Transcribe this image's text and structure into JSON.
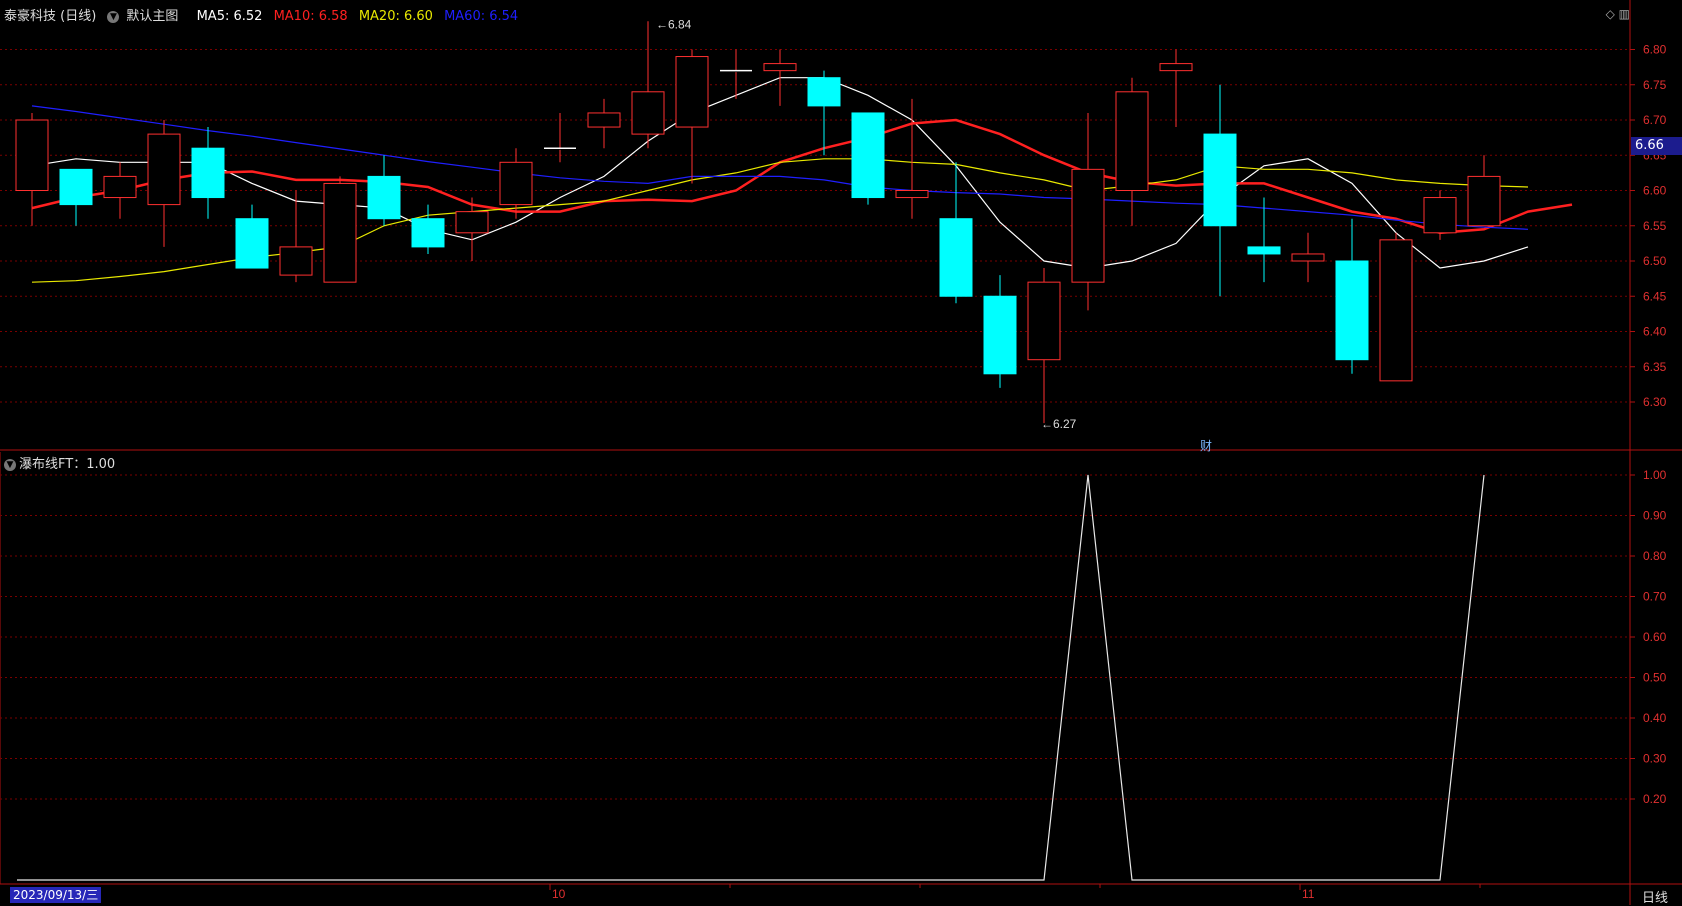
{
  "header": {
    "stock": "泰豪科技 (日线)",
    "main_label": "默认主图",
    "ma": [
      {
        "label": "MA5: 6.52",
        "color": "#ffffff"
      },
      {
        "label": "MA10: 6.58",
        "color": "#ff2020"
      },
      {
        "label": "MA20: 6.60",
        "color": "#e8e800"
      },
      {
        "label": "MA60: 6.54",
        "color": "#1f1fff"
      }
    ]
  },
  "sub_header": "瀑布线FT：1.00",
  "last_price": "6.66",
  "cursor_date": "2023/09/13/三",
  "period": "日线",
  "fin_marker": "财",
  "colors": {
    "up": "#ff3030",
    "down": "#00ffff",
    "grid": "#7a0000",
    "axis": "#b01010"
  },
  "chart_data": {
    "type": "candlestick",
    "y_ticks": [
      "6.80",
      "6.75",
      "6.70",
      "6.65",
      "6.60",
      "6.55",
      "6.50",
      "6.45",
      "6.40",
      "6.35",
      "6.30"
    ],
    "sub_y_ticks": [
      "1.00",
      "0.90",
      "0.80",
      "0.70",
      "0.60",
      "0.50",
      "0.40",
      "0.30",
      "0.20"
    ],
    "x_labels": [
      "10",
      "11"
    ],
    "annotations": {
      "high": "6.84",
      "low": "6.27"
    },
    "candles": [
      {
        "o": 6.6,
        "h": 6.71,
        "l": 6.55,
        "c": 6.7
      },
      {
        "o": 6.63,
        "h": 6.63,
        "l": 6.55,
        "c": 6.58
      },
      {
        "o": 6.59,
        "h": 6.64,
        "l": 6.56,
        "c": 6.62
      },
      {
        "o": 6.58,
        "h": 6.7,
        "l": 6.52,
        "c": 6.68
      },
      {
        "o": 6.66,
        "h": 6.69,
        "l": 6.56,
        "c": 6.59
      },
      {
        "o": 6.56,
        "h": 6.58,
        "l": 6.49,
        "c": 6.49
      },
      {
        "o": 6.48,
        "h": 6.6,
        "l": 6.47,
        "c": 6.52
      },
      {
        "o": 6.47,
        "h": 6.62,
        "l": 6.47,
        "c": 6.61
      },
      {
        "o": 6.62,
        "h": 6.65,
        "l": 6.55,
        "c": 6.56
      },
      {
        "o": 6.56,
        "h": 6.58,
        "l": 6.51,
        "c": 6.52
      },
      {
        "o": 6.54,
        "h": 6.59,
        "l": 6.5,
        "c": 6.57
      },
      {
        "o": 6.58,
        "h": 6.66,
        "l": 6.56,
        "c": 6.64
      },
      {
        "o": 6.66,
        "h": 6.71,
        "l": 6.64,
        "c": 6.66
      },
      {
        "o": 6.69,
        "h": 6.73,
        "l": 6.66,
        "c": 6.71
      },
      {
        "o": 6.68,
        "h": 6.84,
        "l": 6.66,
        "c": 6.74
      },
      {
        "o": 6.69,
        "h": 6.8,
        "l": 6.61,
        "c": 6.79
      },
      {
        "o": 6.77,
        "h": 6.8,
        "l": 6.73,
        "c": 6.77
      },
      {
        "o": 6.77,
        "h": 6.8,
        "l": 6.72,
        "c": 6.78
      },
      {
        "o": 6.76,
        "h": 6.77,
        "l": 6.65,
        "c": 6.72
      },
      {
        "o": 6.71,
        "h": 6.71,
        "l": 6.58,
        "c": 6.59
      },
      {
        "o": 6.59,
        "h": 6.73,
        "l": 6.56,
        "c": 6.6
      },
      {
        "o": 6.56,
        "h": 6.64,
        "l": 6.44,
        "c": 6.45
      },
      {
        "o": 6.45,
        "h": 6.48,
        "l": 6.32,
        "c": 6.34
      },
      {
        "o": 6.36,
        "h": 6.49,
        "l": 6.27,
        "c": 6.47
      },
      {
        "o": 6.47,
        "h": 6.71,
        "l": 6.43,
        "c": 6.63
      },
      {
        "o": 6.6,
        "h": 6.76,
        "l": 6.55,
        "c": 6.74
      },
      {
        "o": 6.77,
        "h": 6.8,
        "l": 6.69,
        "c": 6.78
      },
      {
        "o": 6.68,
        "h": 6.75,
        "l": 6.45,
        "c": 6.55
      },
      {
        "o": 6.52,
        "h": 6.59,
        "l": 6.47,
        "c": 6.51
      },
      {
        "o": 6.5,
        "h": 6.54,
        "l": 6.47,
        "c": 6.51
      },
      {
        "o": 6.5,
        "h": 6.56,
        "l": 6.34,
        "c": 6.36
      },
      {
        "o": 6.33,
        "h": 6.54,
        "l": 6.33,
        "c": 6.53
      },
      {
        "o": 6.54,
        "h": 6.6,
        "l": 6.53,
        "c": 6.59
      },
      {
        "o": 6.55,
        "h": 6.65,
        "l": 6.55,
        "c": 6.62
      }
    ],
    "series": [
      {
        "name": "MA5",
        "color": "#ffffff",
        "values": [
          6.635,
          6.645,
          6.64,
          6.64,
          6.64,
          6.61,
          6.585,
          6.58,
          6.575,
          6.545,
          6.53,
          6.555,
          6.59,
          6.62,
          6.67,
          6.71,
          6.735,
          6.76,
          6.76,
          6.735,
          6.7,
          6.635,
          6.555,
          6.5,
          6.49,
          6.5,
          6.525,
          6.59,
          6.635,
          6.645,
          6.61,
          6.54,
          6.49,
          6.5,
          6.52
        ]
      },
      {
        "name": "MA10",
        "color": "#ff2020",
        "values": [
          6.575,
          6.59,
          6.6,
          6.615,
          6.625,
          6.627,
          6.615,
          6.615,
          6.612,
          6.605,
          6.58,
          6.57,
          6.57,
          6.585,
          6.587,
          6.585,
          6.6,
          6.64,
          6.66,
          6.675,
          6.695,
          6.7,
          6.68,
          6.65,
          6.625,
          6.612,
          6.607,
          6.61,
          6.61,
          6.59,
          6.57,
          6.56,
          6.54,
          6.545,
          6.57,
          6.58
        ]
      },
      {
        "name": "MA20",
        "color": "#e8e800",
        "values": [
          6.47,
          6.472,
          6.478,
          6.485,
          6.495,
          6.505,
          6.512,
          6.52,
          6.55,
          6.565,
          6.57,
          6.575,
          6.58,
          6.585,
          6.6,
          6.615,
          6.625,
          6.64,
          6.645,
          6.645,
          6.64,
          6.637,
          6.625,
          6.615,
          6.6,
          6.607,
          6.615,
          6.635,
          6.63,
          6.63,
          6.625,
          6.615,
          6.61,
          6.607,
          6.605
        ]
      },
      {
        "name": "MA60",
        "color": "#1f1fff",
        "values": [
          6.72,
          6.712,
          6.703,
          6.694,
          6.685,
          6.677,
          6.668,
          6.659,
          6.65,
          6.641,
          6.633,
          6.625,
          6.618,
          6.613,
          6.61,
          6.62,
          6.62,
          6.62,
          6.615,
          6.605,
          6.6,
          6.597,
          6.595,
          6.59,
          6.588,
          6.585,
          6.582,
          6.58,
          6.575,
          6.57,
          6.565,
          6.558,
          6.552,
          6.548,
          6.545
        ]
      }
    ],
    "ft": [
      0,
      0,
      0,
      0,
      0,
      0,
      0,
      0,
      0,
      0,
      0,
      0,
      0,
      0,
      0,
      0,
      0,
      0,
      0,
      0,
      0,
      0,
      0,
      0,
      1,
      0,
      0,
      0,
      0,
      0,
      0,
      0,
      0,
      1
    ]
  }
}
